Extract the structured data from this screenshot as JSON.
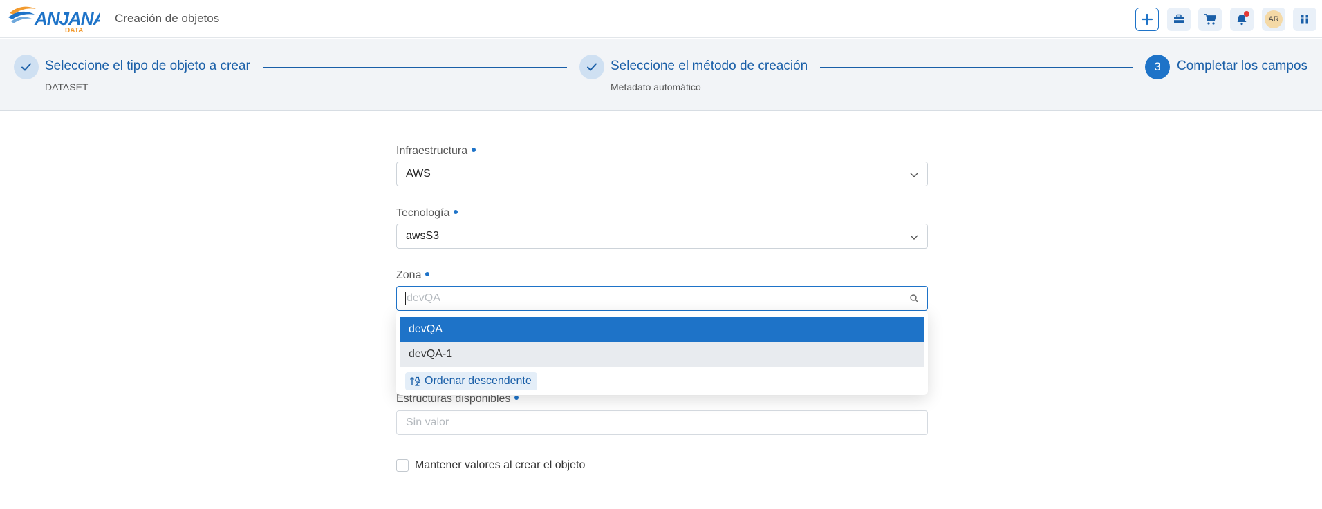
{
  "header": {
    "logo_text": "ANJANA",
    "logo_subtext": "DATA",
    "title": "Creación de objetos",
    "actions": [
      {
        "name": "add",
        "icon": "plus-icon"
      },
      {
        "name": "briefcase",
        "icon": "briefcase-icon"
      },
      {
        "name": "cart",
        "icon": "cart-icon"
      },
      {
        "name": "notifications",
        "icon": "bell-icon",
        "has_badge": true
      },
      {
        "name": "apps",
        "icon": "grid-icon"
      }
    ],
    "avatar_initials": "AR"
  },
  "stepper": {
    "steps": [
      {
        "title": "Seleccione el tipo de objeto a crear",
        "subtitle": "DATASET",
        "state": "done"
      },
      {
        "title": "Seleccione el método de creación",
        "subtitle": "Metadato automático",
        "state": "done"
      },
      {
        "number": "3",
        "title": "Completar los campos",
        "state": "active"
      }
    ]
  },
  "form": {
    "infraestructura": {
      "label": "Infraestructura",
      "value": "AWS",
      "required": true
    },
    "tecnologia": {
      "label": "Tecnología",
      "value": "awsS3",
      "required": true
    },
    "zona": {
      "label": "Zona",
      "placeholder": "devQA",
      "required": true
    },
    "estructuras": {
      "label": "Estructuras disponibles",
      "placeholder": "Sin valor",
      "required": true
    },
    "keep_values": {
      "label": "Mantener valores al crear el objeto",
      "checked": false
    }
  },
  "dropdown": {
    "options": [
      "devQA",
      "devQA-1"
    ],
    "selected": "devQA",
    "sort_label": "Ordenar descendente"
  },
  "colors": {
    "primary": "#1e73c8",
    "primary_dark": "#1a5fa8",
    "stepper_bg": "#f2f4f7",
    "badge": "#e53935"
  }
}
